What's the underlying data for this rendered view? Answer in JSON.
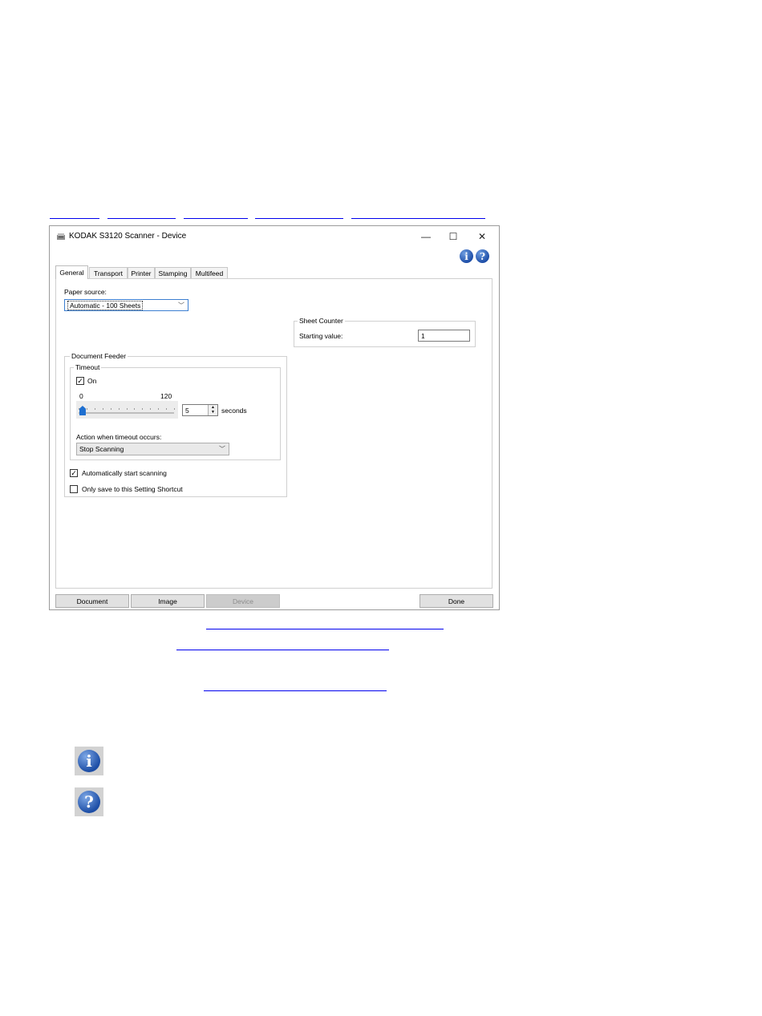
{
  "window": {
    "title": "KODAK S3120 Scanner - Device",
    "controls": {
      "minimize": "—",
      "maximize": "☐",
      "close": "✕"
    }
  },
  "help_icons": {
    "info": "i",
    "help": "?"
  },
  "tabs": [
    {
      "label": "General",
      "active": true
    },
    {
      "label": "Transport",
      "active": false
    },
    {
      "label": "Printer",
      "active": false
    },
    {
      "label": "Stamping",
      "active": false
    },
    {
      "label": "Multifeed",
      "active": false
    }
  ],
  "general": {
    "paper_source_label": "Paper source:",
    "paper_source_value": "Automatic - 100 Sheets",
    "sheet_counter": {
      "title": "Sheet Counter",
      "starting_value_label": "Starting value:",
      "starting_value": "1"
    },
    "document_feeder": {
      "title": "Document Feeder",
      "timeout": {
        "title": "Timeout",
        "on_label": "On",
        "on_checked": true,
        "slider_min": "0",
        "slider_max": "120",
        "slider_value": 5,
        "spin_value": "5",
        "unit_label": "seconds",
        "action_label": "Action when timeout occurs:",
        "action_value": "Stop Scanning"
      },
      "auto_start_label": "Automatically start scanning",
      "auto_start_checked": true,
      "only_save_label": "Only save to this Setting Shortcut",
      "only_save_checked": false
    }
  },
  "bottom_buttons": {
    "document": "Document",
    "image": "Image",
    "device": "Device",
    "done": "Done"
  },
  "doc_icons": {
    "info": "i",
    "help": "?"
  }
}
